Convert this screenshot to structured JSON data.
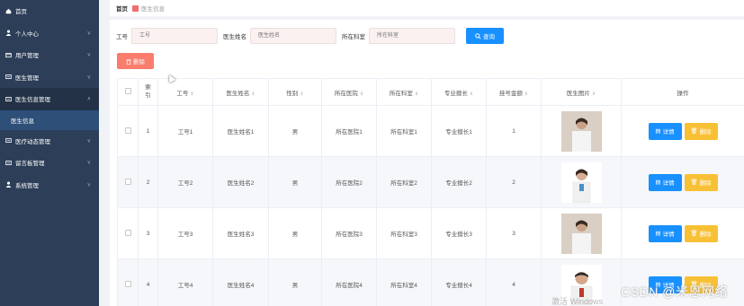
{
  "sidebar": {
    "items": [
      {
        "label": "首页",
        "chevron": false,
        "active": false
      },
      {
        "label": "个人中心",
        "chevron": true,
        "active": false
      },
      {
        "label": "用户管理",
        "chevron": true,
        "active": false
      },
      {
        "label": "医生管理",
        "chevron": true,
        "active": false
      },
      {
        "label": "医生信息管理",
        "chevron": true,
        "active": true
      },
      {
        "label": "医疗动态管理",
        "chevron": true,
        "active": false
      },
      {
        "label": "留言板管理",
        "chevron": true,
        "active": false
      },
      {
        "label": "系统管理",
        "chevron": true,
        "active": false
      }
    ],
    "sub_item": "医生信息"
  },
  "breadcrumb": {
    "home": "首页",
    "current": "医生信息"
  },
  "search": {
    "field1_label": "工号",
    "field1_placeholder": "工号",
    "field2_label": "医生姓名",
    "field2_placeholder": "医生姓名",
    "field3_label": "所在科室",
    "field3_placeholder": "所在科室",
    "query_label": "查询"
  },
  "delete_button_label": "删除",
  "table": {
    "headers": [
      "索引",
      "工号",
      "医生姓名",
      "性别",
      "所在医院",
      "所在科室",
      "专业擅长",
      "挂号金额",
      "医生图片",
      "操作"
    ],
    "rows": [
      {
        "index": "1",
        "id": "工号1",
        "name": "医生姓名1",
        "gender": "男",
        "hospital": "所在医院1",
        "dept": "所在科室1",
        "specialty": "专业擅长1",
        "fee": "1"
      },
      {
        "index": "2",
        "id": "工号2",
        "name": "医生姓名2",
        "gender": "男",
        "hospital": "所在医院2",
        "dept": "所在科室2",
        "specialty": "专业擅长2",
        "fee": "2"
      },
      {
        "index": "3",
        "id": "工号3",
        "name": "医生姓名3",
        "gender": "男",
        "hospital": "所在医院3",
        "dept": "所在科室3",
        "specialty": "专业擅长3",
        "fee": "3"
      },
      {
        "index": "4",
        "id": "工号4",
        "name": "医生姓名4",
        "gender": "男",
        "hospital": "所在医院4",
        "dept": "所在科室4",
        "specialty": "专业擅长4",
        "fee": "4"
      }
    ],
    "detail_label": "详情",
    "delete_label": "删除"
  },
  "overlay": {
    "watermark": "CSDN @米恩网络",
    "activate": "激活 Windows"
  },
  "colors": {
    "sidebar": "#2c3e58",
    "primary": "#1890ff",
    "danger": "#fa7c6d",
    "warning": "#f8c035"
  }
}
